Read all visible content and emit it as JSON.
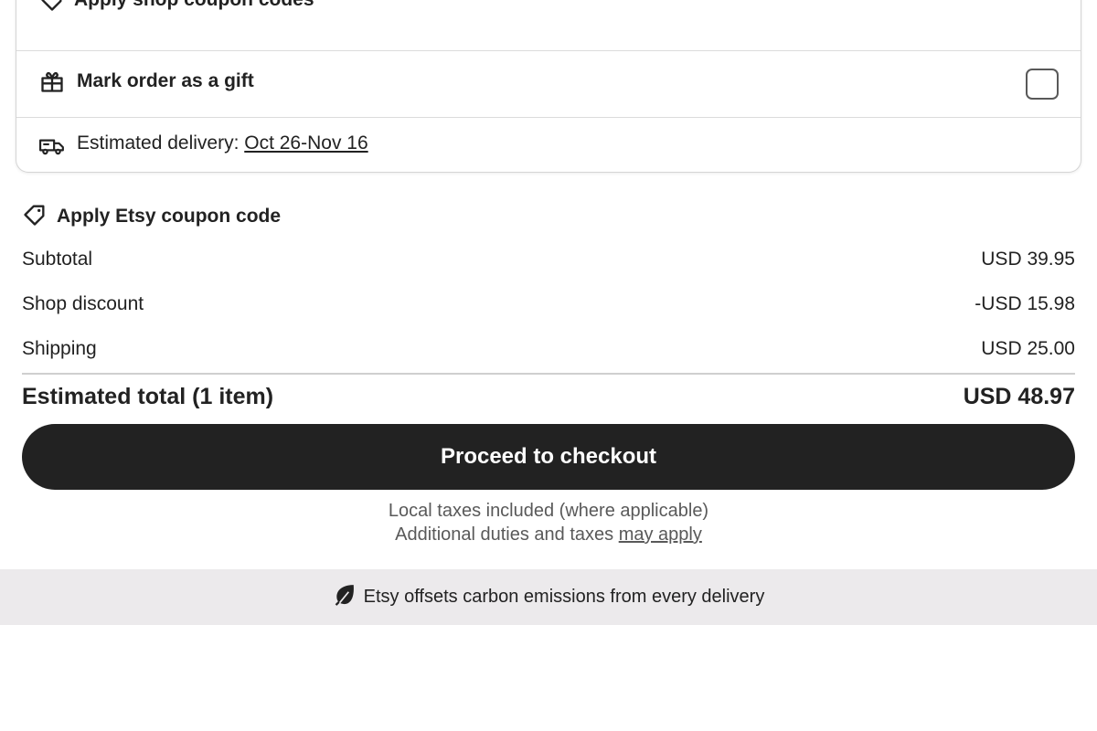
{
  "shop_card": {
    "coupon_label": "Apply shop coupon codes",
    "gift_label": "Mark order as a gift",
    "gift_checked": false,
    "delivery_prefix": "Estimated delivery: ",
    "delivery_range": "Oct 26-Nov 16"
  },
  "etsy_coupon": {
    "label": "Apply Etsy coupon code"
  },
  "summary": {
    "subtotal_label": "Subtotal",
    "subtotal_value": "USD 39.95",
    "discount_label": "Shop discount",
    "discount_value": "-USD 15.98",
    "shipping_label": "Shipping",
    "shipping_value": "USD 25.00",
    "total_label": "Estimated total (1 item)",
    "total_value": "USD 48.97"
  },
  "checkout": {
    "button_label": "Proceed to checkout"
  },
  "tax": {
    "line1": "Local taxes included (where applicable)",
    "line2_prefix": "Additional duties and taxes ",
    "line2_link": "may apply"
  },
  "carbon": {
    "text": "Etsy offsets carbon emissions from every delivery"
  },
  "colors": {
    "text": "#222222",
    "muted": "#595959",
    "button_bg": "#222222",
    "button_text": "#ffffff",
    "banner_bg": "#eceaec",
    "border": "#d5d5d5"
  },
  "icons": [
    "tag-icon",
    "gift-icon",
    "delivery-truck-icon",
    "leaf-icon"
  ]
}
